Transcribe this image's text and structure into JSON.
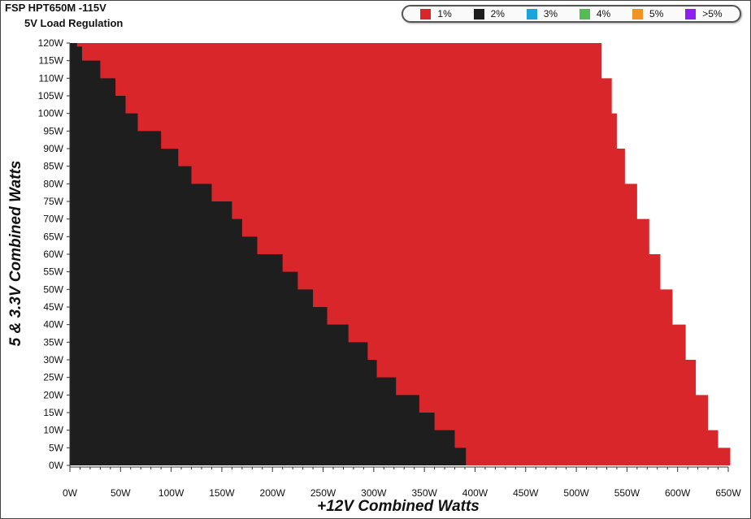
{
  "chart_data": {
    "type": "heatmap",
    "title": "FSP HPT650M -115V",
    "subtitle": "5V Load Regulation",
    "xlabel": "+12V Combined Watts",
    "ylabel": "5 & 3.3V Combined Watts",
    "xlim": [
      0,
      650
    ],
    "ylim": [
      0,
      120
    ],
    "x_ticks": [
      "0W",
      "50W",
      "100W",
      "150W",
      "200W",
      "250W",
      "300W",
      "350W",
      "400W",
      "450W",
      "500W",
      "550W",
      "600W",
      "650W"
    ],
    "y_ticks": [
      "0W",
      "5W",
      "10W",
      "15W",
      "20W",
      "25W",
      "30W",
      "35W",
      "40W",
      "45W",
      "50W",
      "55W",
      "60W",
      "65W",
      "70W",
      "75W",
      "80W",
      "85W",
      "90W",
      "95W",
      "100W",
      "105W",
      "110W",
      "115W",
      "120W"
    ],
    "legend": [
      {
        "label": "1%",
        "color": "#d9262a"
      },
      {
        "label": "2%",
        "color": "#1e1e1e"
      },
      {
        "label": "3%",
        "color": "#1aa3dd"
      },
      {
        "label": "4%",
        "color": "#55bb55"
      },
      {
        "label": "5%",
        "color": "#f29222"
      },
      {
        "label": ">5%",
        "color": "#8f1ff0"
      }
    ],
    "boundary_2pct": {
      "description_points_x_at_y": [
        [
          0,
          391
        ],
        [
          5,
          380
        ],
        [
          10,
          360
        ],
        [
          15,
          345
        ],
        [
          20,
          322
        ],
        [
          25,
          303
        ],
        [
          30,
          294
        ],
        [
          35,
          275
        ],
        [
          40,
          254
        ],
        [
          45,
          240
        ],
        [
          50,
          225
        ],
        [
          55,
          210
        ],
        [
          60,
          185
        ],
        [
          65,
          170
        ],
        [
          70,
          160
        ],
        [
          75,
          140
        ],
        [
          80,
          120
        ],
        [
          85,
          107
        ],
        [
          90,
          90
        ],
        [
          95,
          67
        ],
        [
          100,
          55
        ],
        [
          105,
          45
        ],
        [
          110,
          30
        ],
        [
          115,
          12
        ],
        [
          119,
          7
        ],
        [
          120,
          0
        ]
      ]
    },
    "max_load_edge": [
      [
        0,
        652
      ],
      [
        5,
        640
      ],
      [
        10,
        630
      ],
      [
        20,
        618
      ],
      [
        30,
        608
      ],
      [
        40,
        595
      ],
      [
        50,
        583
      ],
      [
        60,
        572
      ],
      [
        70,
        560
      ],
      [
        80,
        548
      ],
      [
        90,
        540
      ],
      [
        100,
        535
      ],
      [
        110,
        525
      ],
      [
        120,
        525
      ]
    ]
  }
}
